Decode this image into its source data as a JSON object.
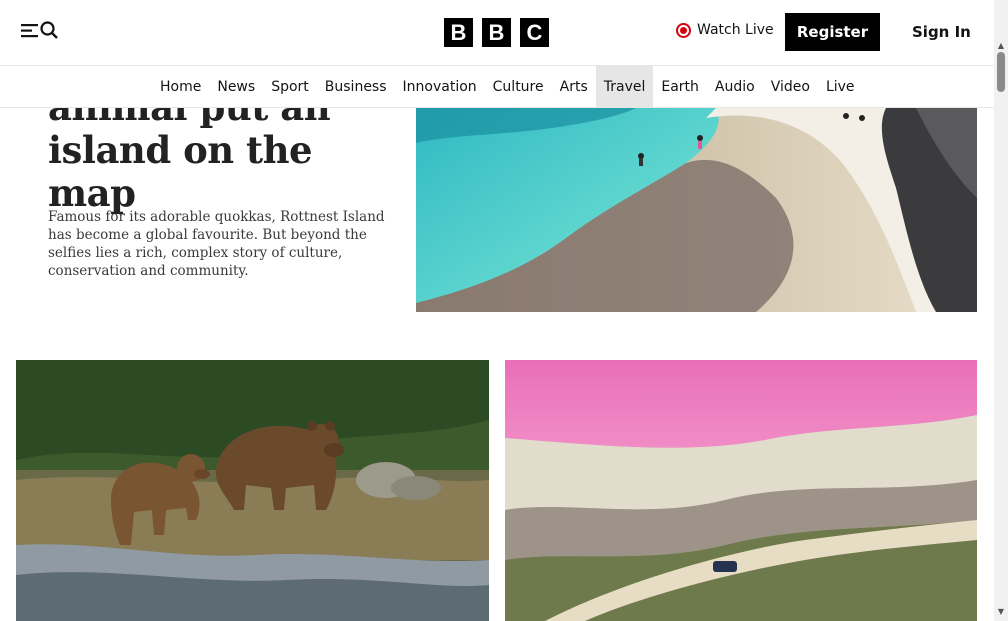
{
  "header": {
    "menu_icon": "menu-icon",
    "search_icon": "search-icon",
    "logo_letters": [
      "B",
      "B",
      "C"
    ],
    "watch_live": "Watch Live",
    "register": "Register",
    "sign_in": "Sign In"
  },
  "nav": {
    "items": [
      "Home",
      "News",
      "Sport",
      "Business",
      "Innovation",
      "Culture",
      "Arts",
      "Travel",
      "Earth",
      "Audio",
      "Video",
      "Live"
    ],
    "active": "Travel"
  },
  "hero": {
    "title_line1": "animal put an",
    "title_line2": "island on the map",
    "description": "Famous for its adorable quokkas, Rottnest Island has become a global favourite. But beyond the selfies lies a rich, complex story of culture, conservation and community."
  },
  "colors": {
    "accent_live": "#d4000f",
    "brand_black": "#000000",
    "active_nav_bg": "#e6e6e6"
  }
}
